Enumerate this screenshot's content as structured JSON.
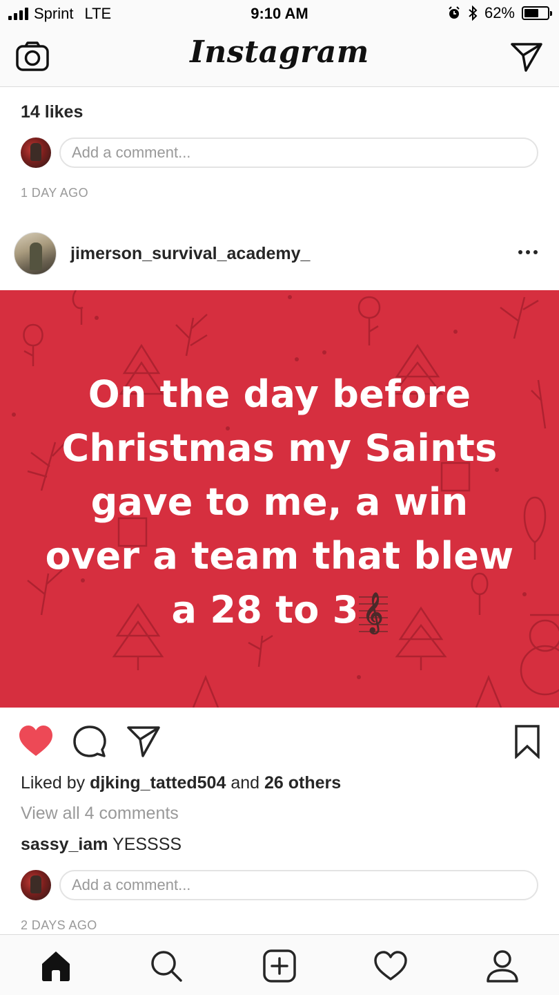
{
  "status_bar": {
    "carrier": "Sprint",
    "network": "LTE",
    "time": "9:10 AM",
    "battery_percent": "62%",
    "battery_level": 0.62,
    "icons": [
      "signal-icon",
      "alarm-icon",
      "bluetooth-icon",
      "battery-icon"
    ]
  },
  "header": {
    "logo": "Instagram",
    "left_icon": "camera-icon",
    "right_icon": "direct-message-icon"
  },
  "previous_post": {
    "likes": "14 likes",
    "comment_placeholder": "Add a comment...",
    "timestamp": "1 DAY AGO"
  },
  "post": {
    "username": "jimerson_survival_academy_",
    "image_text_lines": [
      "On the day before",
      "Christmas my Saints",
      "gave to me, a win",
      "over a team that blew",
      "a 28 to 3"
    ],
    "image_emoji": "𝄞",
    "image_background": "#d62f3f",
    "liked": true,
    "like_color": "#ed4956",
    "liked_by_prefix": "Liked by",
    "liked_by_user": "djking_tatted504",
    "liked_by_connector": "and",
    "liked_by_others": "26 others",
    "view_comments": "View all 4 comments",
    "comment": {
      "user": "sassy_iam",
      "text": "YESSSS"
    },
    "comment_placeholder": "Add a comment...",
    "timestamp": "2 DAYS AGO"
  },
  "tab_bar": {
    "tabs": [
      "home-icon",
      "search-icon",
      "new-post-icon",
      "activity-icon",
      "profile-icon"
    ],
    "active": "home-icon"
  }
}
